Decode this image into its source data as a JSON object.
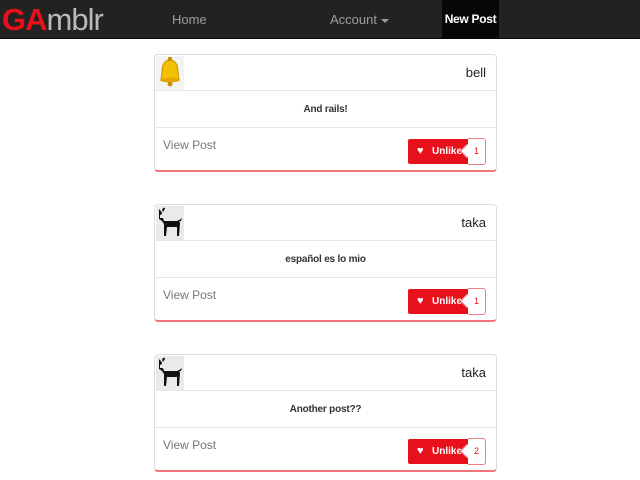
{
  "navbar": {
    "brand_part1": "GA",
    "brand_part2": "mblr",
    "home": "Home",
    "account": "Account",
    "new_post": "New Post"
  },
  "posts": [
    {
      "author": "bell",
      "avatar_icon": "bell-icon",
      "body": "And rails!",
      "view_label": "View Post",
      "unlike_label": "Unlike",
      "likes": "1"
    },
    {
      "author": "taka",
      "avatar_icon": "goat-icon",
      "body": "español es lo mio",
      "view_label": "View Post",
      "unlike_label": "Unlike",
      "likes": "1"
    },
    {
      "author": "taka",
      "avatar_icon": "goat-icon",
      "body": "Another post??",
      "view_label": "View Post",
      "unlike_label": "Unlike",
      "likes": "2"
    }
  ],
  "colors": {
    "accent": "#e8101a",
    "navbar": "#222222"
  }
}
